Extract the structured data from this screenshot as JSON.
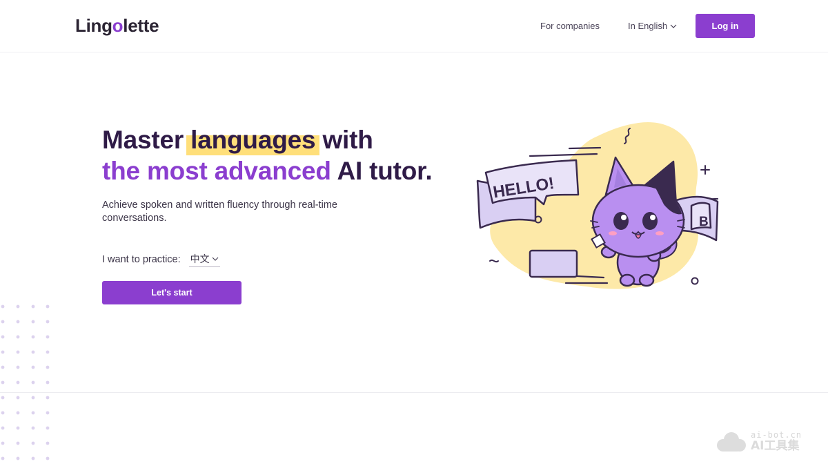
{
  "header": {
    "logo_prefix": "Ling",
    "logo_o": "o",
    "logo_suffix": "lette",
    "for_companies": "For companies",
    "language": "In English",
    "login": "Log in"
  },
  "hero": {
    "title_part1": "Master ",
    "title_highlight": "languages",
    "title_part2": " with",
    "title_line2_purple": "the most advanced",
    "title_line2_rest": " AI tutor.",
    "subtitle": "Achieve spoken and written fluency through real-time conversations.",
    "practice_label": "I want to practice:",
    "practice_value": "中文",
    "start_button": "Let's start"
  },
  "illustration": {
    "speech_left": "HELLO!",
    "speech_right": "B"
  },
  "watermark": {
    "small": "ai-bot.cn",
    "big": "AI工具集"
  },
  "colors": {
    "brand_purple": "#8b3ecf",
    "highlight_yellow": "#ffdf7a",
    "title_dark": "#2f1b47",
    "blob_yellow": "#fde9a8",
    "cat_purple": "#b98ff0",
    "banner_lavender": "#d9cff3"
  }
}
